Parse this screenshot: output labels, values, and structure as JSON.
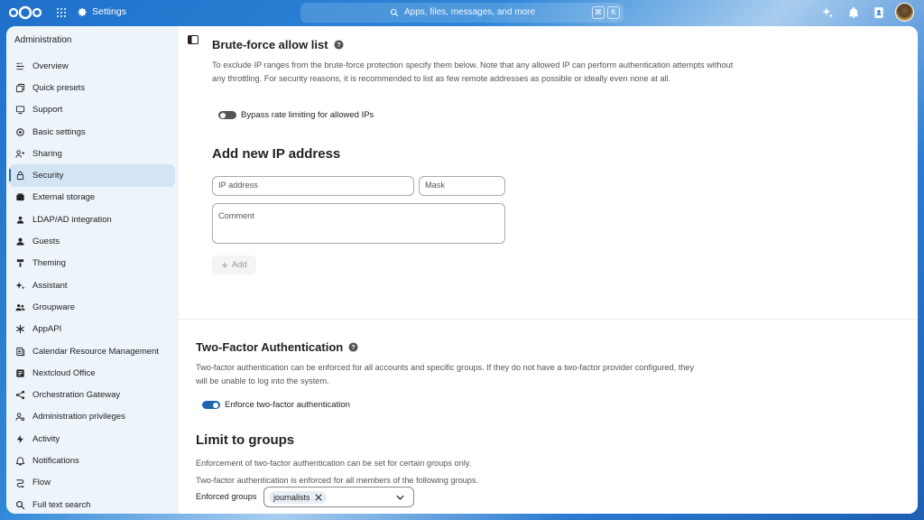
{
  "header": {
    "app_title": "Settings",
    "search_placeholder": "Apps, files, messages, and more",
    "shortcut_key1": "⌘",
    "shortcut_key2": "K"
  },
  "sidebar": {
    "title": "Administration",
    "items": [
      {
        "label": "Overview",
        "icon": "overview-icon"
      },
      {
        "label": "Quick presets",
        "icon": "presets-icon"
      },
      {
        "label": "Support",
        "icon": "support-icon"
      },
      {
        "label": "Basic settings",
        "icon": "gear-icon"
      },
      {
        "label": "Sharing",
        "icon": "share-icon"
      },
      {
        "label": "Security",
        "icon": "lock-icon",
        "active": true
      },
      {
        "label": "External storage",
        "icon": "storage-icon"
      },
      {
        "label": "LDAP/AD integration",
        "icon": "user-icon"
      },
      {
        "label": "Guests",
        "icon": "guest-icon"
      },
      {
        "label": "Theming",
        "icon": "paint-icon"
      },
      {
        "label": "Assistant",
        "icon": "sparkle-icon"
      },
      {
        "label": "Groupware",
        "icon": "group-icon"
      },
      {
        "label": "AppAPI",
        "icon": "api-icon"
      },
      {
        "label": "Calendar Resource Management",
        "icon": "calendar-icon"
      },
      {
        "label": "Nextcloud Office",
        "icon": "office-icon"
      },
      {
        "label": "Orchestration Gateway",
        "icon": "gateway-icon"
      },
      {
        "label": "Administration privileges",
        "icon": "admin-icon"
      },
      {
        "label": "Activity",
        "icon": "activity-icon"
      },
      {
        "label": "Notifications",
        "icon": "bell-icon"
      },
      {
        "label": "Flow",
        "icon": "flow-icon"
      },
      {
        "label": "Full text search",
        "icon": "search-icon"
      }
    ]
  },
  "bruteforce": {
    "title": "Brute-force allow list",
    "description": "To exclude IP ranges from the brute-force protection specify them below. Note that any allowed IP can perform authentication attempts without any throttling. For security reasons, it is recommended to list as few remote addresses as possible or ideally even none at all.",
    "bypass_label": "Bypass rate limiting for allowed IPs",
    "bypass_enabled": false,
    "add_title": "Add new IP address",
    "ip_placeholder": "IP address",
    "mask_placeholder": "Mask",
    "comment_placeholder": "Comment",
    "add_button": "Add"
  },
  "twofactor": {
    "title": "Two-Factor Authentication",
    "description": "Two-factor authentication can be enforced for all accounts and specific groups. If they do not have a two-factor provider configured, they will be unable to log into the system.",
    "enforce_label": "Enforce two-factor authentication",
    "enforce_enabled": true,
    "limit_title": "Limit to groups",
    "limit_desc1": "Enforcement of two-factor authentication can be set for certain groups only.",
    "limit_desc2": "Two-factor authentication is enforced for all members of the following groups.",
    "enforced_groups_label": "Enforced groups",
    "enforced_groups": [
      "journalists"
    ]
  },
  "colors": {
    "accent": "#1e66b2",
    "header_bg": "#2b7bd1"
  }
}
